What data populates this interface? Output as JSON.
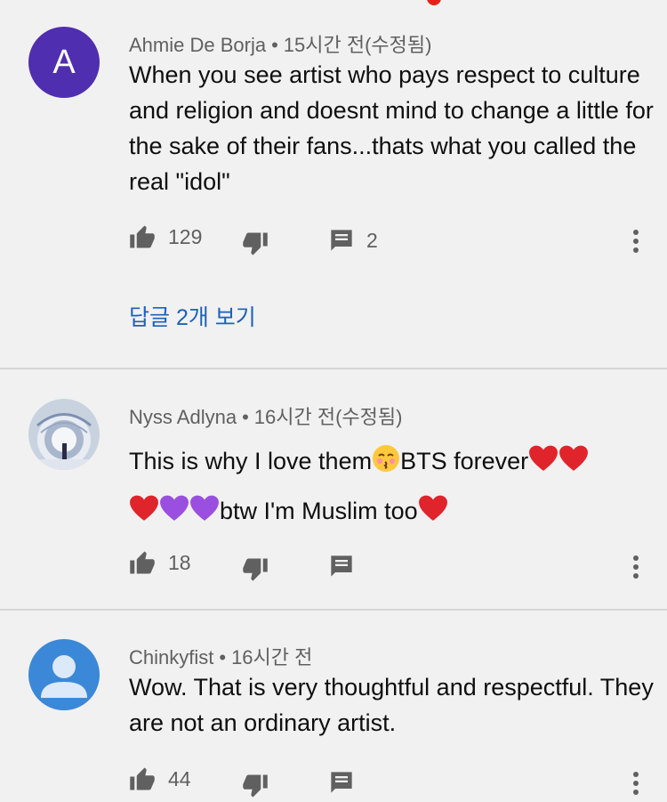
{
  "comments": [
    {
      "avatar_letter": "A",
      "author": "Ahmie De Borja",
      "separator": "•",
      "time": "15시간 전(수정됨)",
      "text": "When you see artist who pays respect to culture and religion and doesnt mind to change a little for the sake of their fans...thats what you called the real \"idol\"",
      "likes": "129",
      "reply_count": "2",
      "view_replies": "답글 2개 보기"
    },
    {
      "author": "Nyss Adlyna",
      "separator": "•",
      "time": "16시간 전(수정됨)",
      "text_part1": "This is why I love them",
      "text_part2": "BTS forever",
      "text_part3": "btw I'm Muslim too",
      "likes": "18"
    },
    {
      "author": "Chinkyfist",
      "separator": "•",
      "time": "16시간 전",
      "text": "Wow. That is very thoughtful and respectful. They are not an ordinary artist.",
      "likes": "44"
    }
  ],
  "colors": {
    "background": "#f1f1f1",
    "link": "#1c62b9",
    "avatar_purple": "#4f2eb0",
    "avatar_blue": "#3b88d8",
    "meta_text": "#606060",
    "heart": "#e0242b",
    "purple_heart": "#9b4fe0"
  },
  "icons": [
    "thumbs-up-icon",
    "thumbs-down-icon",
    "reply-icon",
    "more-vert-icon",
    "kissing-face-emoji",
    "red-heart-emoji",
    "purple-heart-emoji"
  ]
}
